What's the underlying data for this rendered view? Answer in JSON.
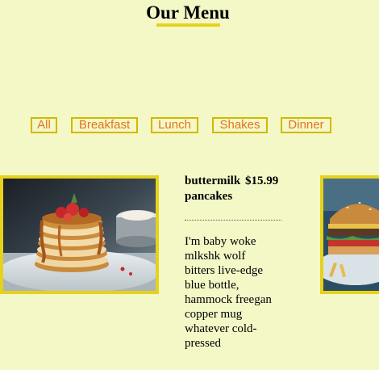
{
  "header": {
    "title": "Our Menu"
  },
  "filters": [
    {
      "label": "All"
    },
    {
      "label": "Breakfast"
    },
    {
      "label": "Lunch"
    },
    {
      "label": "Shakes"
    },
    {
      "label": "Dinner"
    }
  ],
  "menu_item": {
    "name": "buttermilk pancakes",
    "price": "$15.99",
    "description": "I'm baby woke mlkshk wolf bitters live-edge blue bottle, hammock freegan copper mug whatever cold-pressed"
  },
  "colors": {
    "background": "#f3f8c6",
    "accent": "#e6d21b",
    "button_text": "#e6731f"
  }
}
